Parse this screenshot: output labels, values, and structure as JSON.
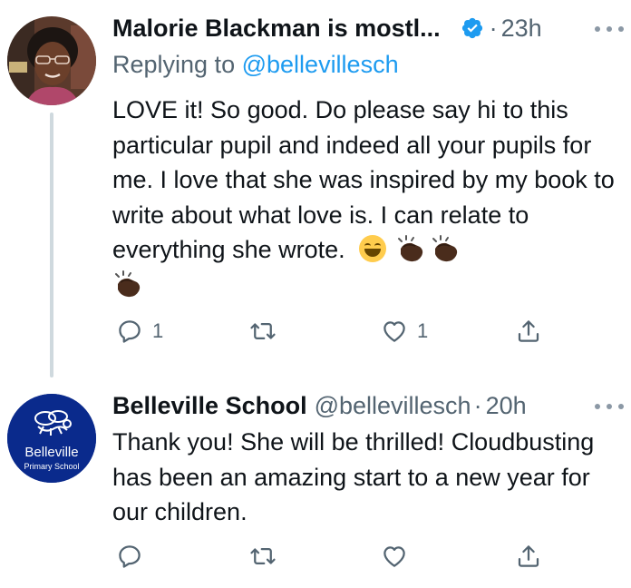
{
  "tweets": [
    {
      "author_name": "Malorie Blackman is mostl...",
      "verified": true,
      "time": "23h",
      "replying_prefix": "Replying to",
      "replying_to": "@bellevillesch",
      "text": "LOVE it!  So good. Do please say hi to this particular pupil and indeed all your pupils for me. I love that she was inspired by my book to write about what love is. I can relate to everything she wrote.",
      "emojis": [
        "grinning-face",
        "clapping-hands",
        "clapping-hands",
        "clapping-hands"
      ],
      "reply_count": "1",
      "like_count": "1"
    },
    {
      "author_name": "Belleville School",
      "handle": "@bellevillesch",
      "time": "20h",
      "text": "Thank you! She will be thrilled! Cloudbusting has been an amazing start to a new year for our children.",
      "avatar_text_line1": "Belleville",
      "avatar_text_line2": "Primary School"
    }
  ],
  "colors": {
    "text": "#0f1419",
    "secondary": "#536471",
    "link": "#1d9bf0",
    "thread_line": "#cfd9de",
    "school_avatar_bg": "#0a2a8c"
  },
  "separator": "·"
}
